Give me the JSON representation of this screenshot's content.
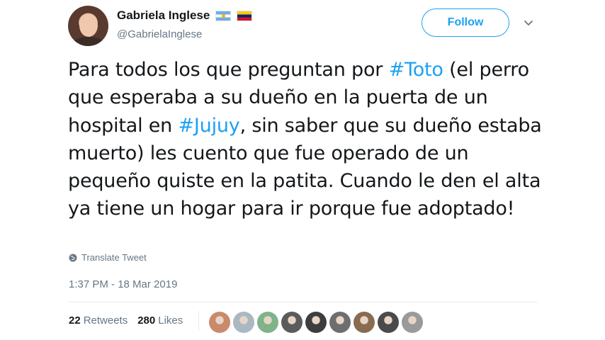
{
  "user": {
    "display_name": "Gabriela Inglese",
    "handle": "@GabrielaInglese",
    "flags": [
      "argentina-flag",
      "venezuela-flag"
    ]
  },
  "follow_button": {
    "label": "Follow"
  },
  "tweet": {
    "segments": [
      {
        "text": "Para todos los que preguntan por ",
        "type": "text"
      },
      {
        "text": "#Toto",
        "type": "hashtag"
      },
      {
        "text": " (el perro que esperaba a su dueño en la puerta de un hospital en ",
        "type": "text"
      },
      {
        "text": "#Jujuy",
        "type": "hashtag"
      },
      {
        "text": ", sin saber que su dueño estaba muerto) les cuento que fue operado de un pequeño quiste en la patita. Cuando le den el alta ya tiene un hogar para ir porque fue adoptado!",
        "type": "text"
      }
    ]
  },
  "translate_label": "Translate Tweet",
  "timestamp": "1:37 PM - 18 Mar 2019",
  "stats": {
    "retweets_count": "22",
    "retweets_label": "Retweets",
    "likes_count": "280",
    "likes_label": "Likes"
  },
  "likers": [
    {
      "name": "liker-avatar-1",
      "color": "#c98a6b"
    },
    {
      "name": "liker-avatar-2",
      "color": "#aab8c2"
    },
    {
      "name": "liker-avatar-3",
      "color": "#7fb38a"
    },
    {
      "name": "liker-avatar-4",
      "color": "#5b5b5b"
    },
    {
      "name": "liker-avatar-5",
      "color": "#3d3d3d"
    },
    {
      "name": "liker-avatar-6",
      "color": "#6e6e6e"
    },
    {
      "name": "liker-avatar-7",
      "color": "#8a6b4f"
    },
    {
      "name": "liker-avatar-8",
      "color": "#4a4a4a"
    },
    {
      "name": "liker-avatar-9",
      "color": "#9a9a9a"
    }
  ],
  "colors": {
    "accent": "#1da1f2",
    "text": "#14171a",
    "muted": "#657786"
  }
}
